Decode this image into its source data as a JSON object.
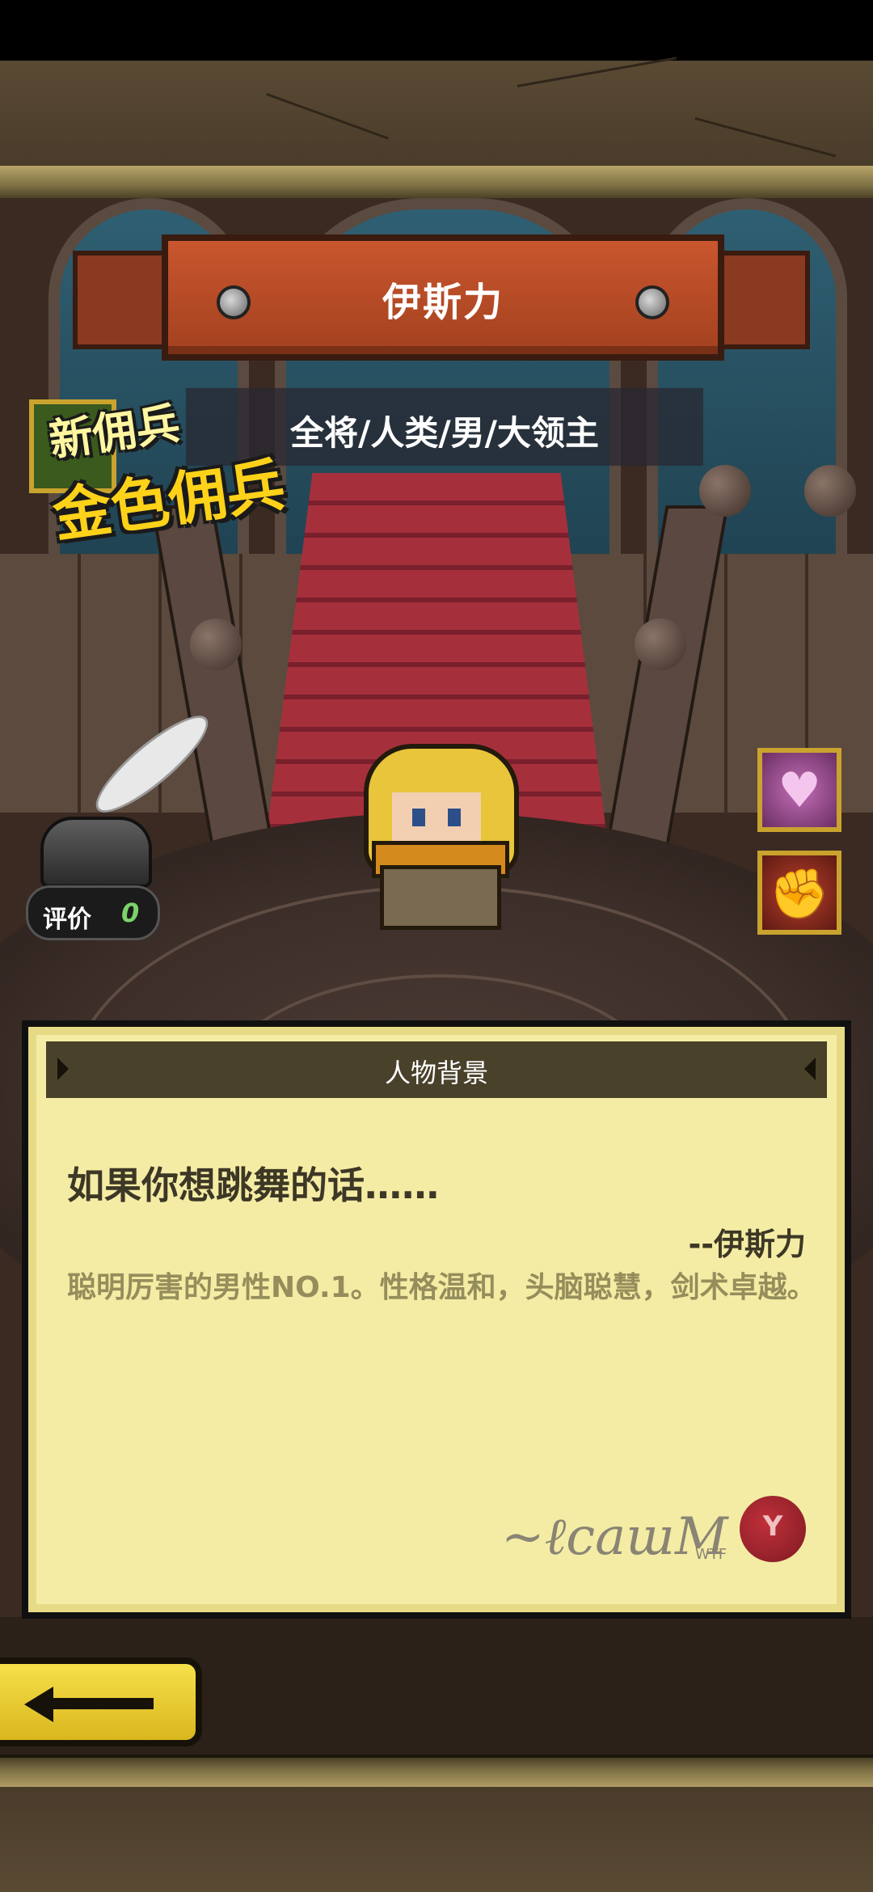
{
  "hero": {
    "name": "伊斯力",
    "tags": "全将/人类/男/大领主"
  },
  "badge": {
    "line1": "新佣兵",
    "line2": "金色佣兵"
  },
  "rating": {
    "label": "评价",
    "value": "0"
  },
  "skills": [
    {
      "icon": "broken-heart-icon"
    },
    {
      "icon": "gauntlet-fist-icon"
    }
  ],
  "background_panel": {
    "title": "人物背景",
    "quote": "如果你想跳舞的话……",
    "author": "--伊斯力",
    "description": "聪明厉害的男性NO.1。性格温和，头脑聪慧，剑术卓越。",
    "signature_mark": "WTF",
    "seal_mark": "Y"
  },
  "colors": {
    "banner": "#c9562e",
    "panel": "#f4eca4",
    "back_button": "#f6e04a",
    "badge_text": "#ffd21a"
  }
}
